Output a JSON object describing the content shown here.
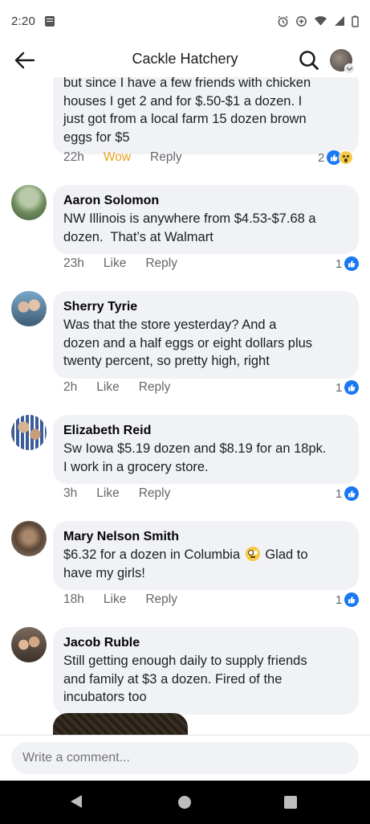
{
  "status_bar": {
    "time": "2:20",
    "icons": [
      "message-icon",
      "alarm-icon",
      "data-saver-icon",
      "wifi-icon",
      "signal-icon",
      "battery-icon"
    ]
  },
  "header": {
    "title": "Cackle Hatchery",
    "back_icon": "arrow-left-icon",
    "search_icon": "search-icon",
    "profile_icon": "profile-avatar-icon"
  },
  "comments": [
    {
      "author": "",
      "text_lines": [
        "but since I have a few friends with chicken",
        "houses I get 2 and for $.50-$1 a dozen. I",
        "just got from a local farm 15 dozen brown",
        "eggs for $5"
      ],
      "time": "22h",
      "reaction_label": "Wow",
      "reply_label": "Reply",
      "reaction_count": "2",
      "reaction_types": [
        "like",
        "wow"
      ]
    },
    {
      "author": "Aaron Solomon",
      "text": "NW Illinois is anywhere from $4.53-$7.68 a\ndozen.  That’s at Walmart",
      "time": "23h",
      "like_label": "Like",
      "reply_label": "Reply",
      "reaction_count": "1",
      "reaction_types": [
        "like"
      ]
    },
    {
      "author": "Sherry Tyrie",
      "text": "Was that the store yesterday? And a\ndozen and a half eggs or eight dollars plus\ntwenty percent, so pretty high, right",
      "time": "2h",
      "like_label": "Like",
      "reply_label": "Reply",
      "reaction_count": "1",
      "reaction_types": [
        "like"
      ]
    },
    {
      "author": "Elizabeth Reid",
      "text": "Sw Iowa $5.19 dozen and $8.19 for an 18pk.\nI work in a grocery store.",
      "time": "3h",
      "like_label": "Like",
      "reply_label": "Reply",
      "reaction_count": "1",
      "reaction_types": [
        "like"
      ]
    },
    {
      "author": "Mary Nelson Smith",
      "text_before_emoji": "$6.32 for a dozen in Columbia",
      "emoji": "flushed-face-emoji",
      "text_after_emoji": "Glad to",
      "text_line2": "have my girls!",
      "time": "18h",
      "like_label": "Like",
      "reply_label": "Reply",
      "reaction_count": "1",
      "reaction_types": [
        "like"
      ]
    },
    {
      "author": "Jacob Ruble",
      "text": "Still getting enough daily to supply friends\nand family at $3 a dozen. Fired of the\nincubators too",
      "has_image": true
    }
  ],
  "composer": {
    "placeholder": "Write a comment..."
  },
  "colors": {
    "like_blue": "#1877f2",
    "wow_yellow": "#e8a21b",
    "bubble_bg": "#f0f2f5",
    "meta_gray": "#65676b"
  }
}
